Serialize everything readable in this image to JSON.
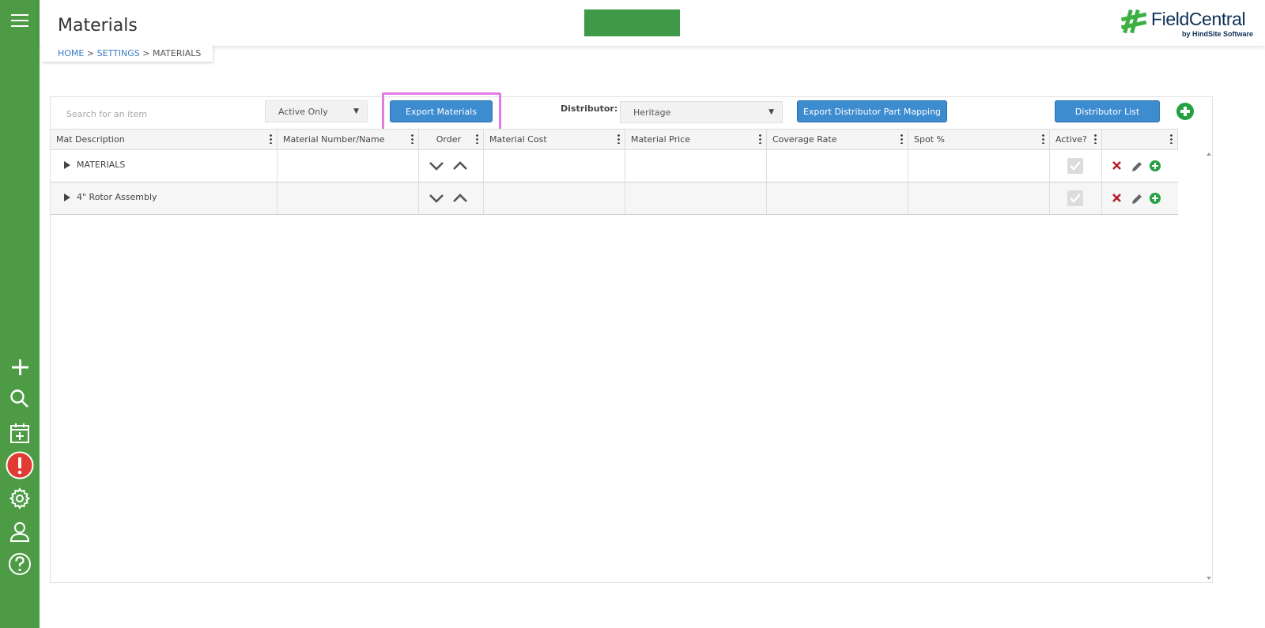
{
  "header": {
    "title": "Materials",
    "logo_name": "FieldCentral",
    "logo_subtitle": "by HindSite Software"
  },
  "breadcrumb": {
    "home": "HOME",
    "settings": "SETTINGS",
    "current": "MATERIALS",
    "separator": " > "
  },
  "toolbar": {
    "search_placeholder": "Search for an item",
    "filter_value": "Active Only",
    "export_materials_label": "Export Materials",
    "distributor_label": "Distributor:",
    "distributor_value": "Heritage",
    "export_mapping_label": "Export Distributor Part Mapping",
    "distributor_list_label": "Distributor List"
  },
  "grid": {
    "columns": [
      "Mat Description",
      "Material Number/Name",
      "Order",
      "Material Cost",
      "Material Price",
      "Coverage Rate",
      "Spot %",
      "Active?",
      ""
    ],
    "rows": [
      {
        "description": "MATERIALS",
        "number": "",
        "cost": "",
        "price": "",
        "coverage": "",
        "spot": "",
        "active": true
      },
      {
        "description": "4\" Rotor Assembly",
        "number": "",
        "cost": "",
        "price": "",
        "coverage": "",
        "spot": "",
        "active": true
      }
    ]
  },
  "sidebar": {
    "items": [
      "menu-icon",
      "plus-icon",
      "search-icon",
      "calendar-add-icon",
      "alert-icon",
      "gear-icon",
      "user-icon",
      "help-icon"
    ]
  },
  "colors": {
    "sidebar": "#4d9c45",
    "primary_button": "#3e8cd0",
    "highlight": "#e57be6",
    "add_green": "#25a042",
    "delete_red": "#b3202a",
    "alert_red": "#e03a33"
  }
}
